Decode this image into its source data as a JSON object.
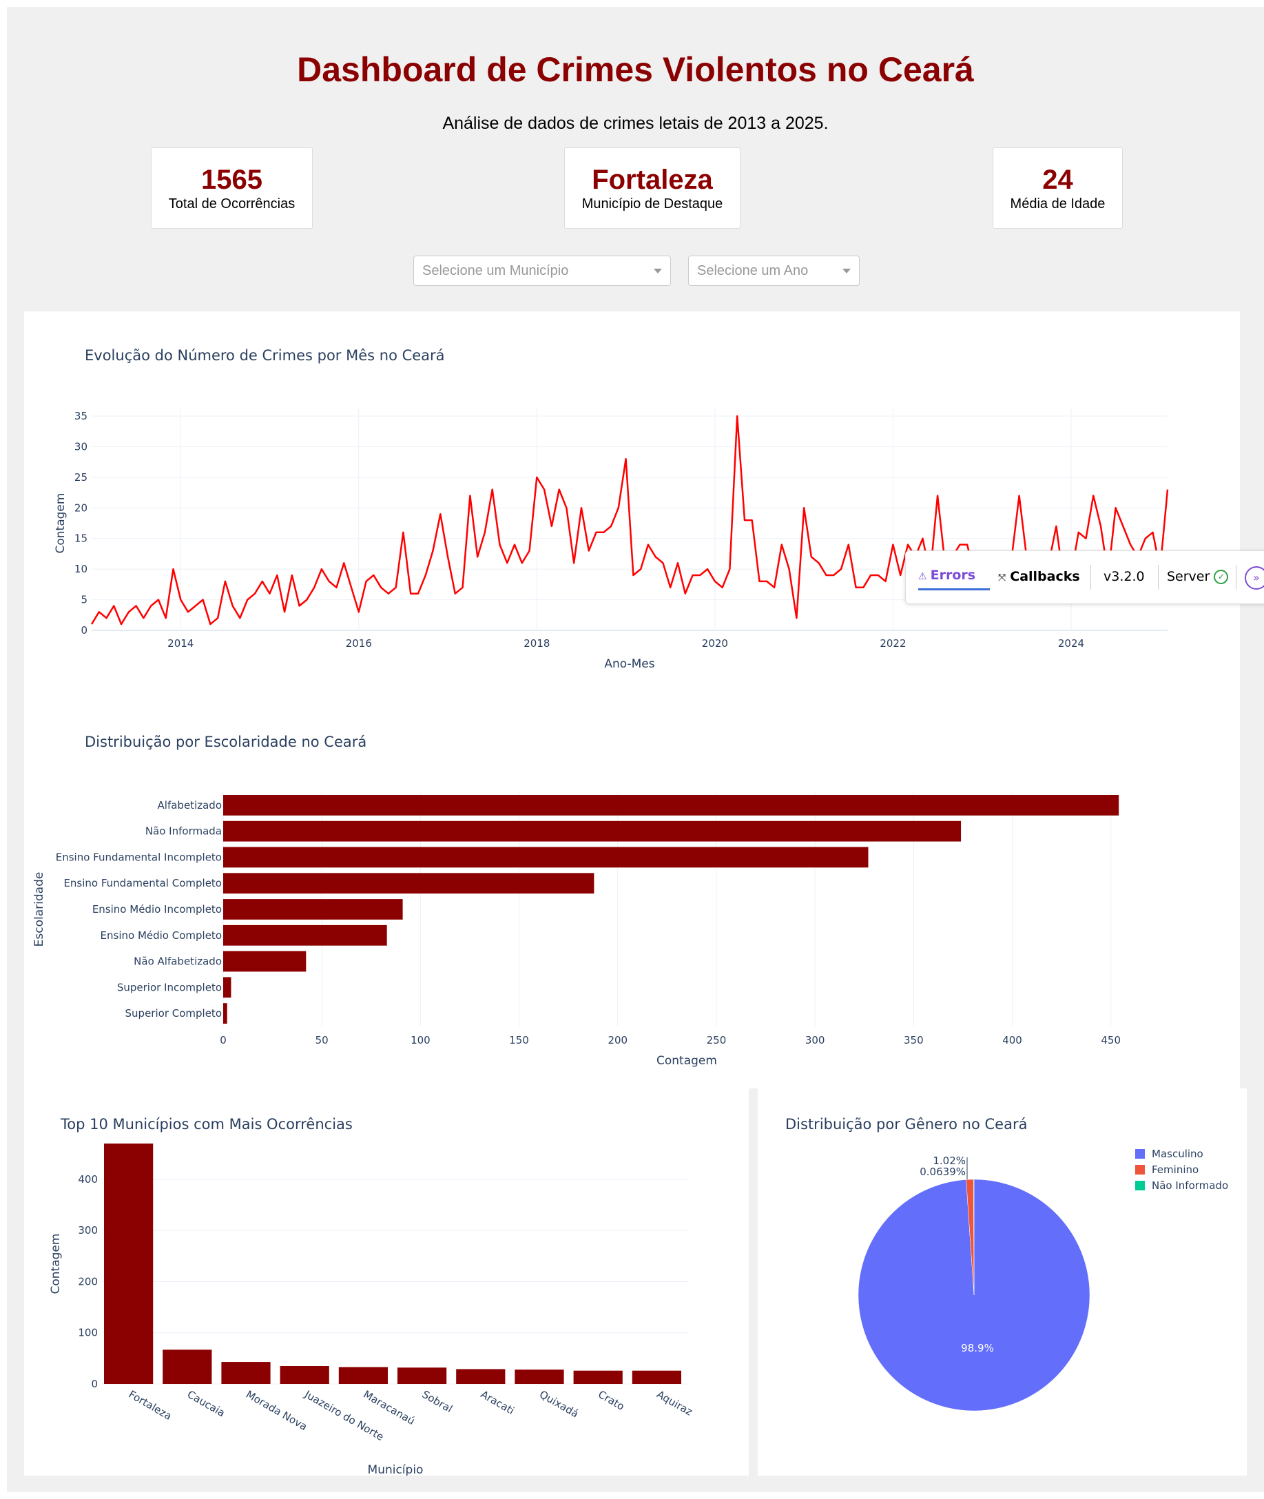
{
  "header": {
    "title": "Dashboard de Crimes Violentos no Ceará",
    "subtitle": "Análise de dados de crimes letais de 2013 a 2025."
  },
  "cards": [
    {
      "value": "1565",
      "label": "Total de Ocorrências"
    },
    {
      "value": "Fortaleza",
      "label": "Município de Destaque"
    },
    {
      "value": "24",
      "label": "Média de Idade"
    }
  ],
  "filters": {
    "municipio_placeholder": "Selecione um Município",
    "ano_placeholder": "Selecione um Ano"
  },
  "devtools": {
    "errors_label": "Errors",
    "callbacks_label": "Callbacks",
    "version": "v3.2.0",
    "server_label": "Server"
  },
  "colors": {
    "accent": "#8b0000",
    "line": "#ff0000",
    "masculino": "#636efa",
    "feminino": "#ef553b",
    "nao_informado": "#00cc96"
  },
  "chart_data": [
    {
      "type": "line",
      "title": "Evolução do Número de Crimes por Mês no Ceará",
      "xlabel": "Ano-Mes",
      "ylabel": "Contagem",
      "x_start": "2013-01",
      "x_end": "2024-12",
      "xticks": [
        "2014",
        "2016",
        "2018",
        "2020",
        "2022",
        "2024"
      ],
      "yticks": [
        0,
        5,
        10,
        15,
        20,
        25,
        30,
        35
      ],
      "ylim": [
        0,
        35
      ],
      "values": [
        1,
        3,
        2,
        4,
        1,
        3,
        4,
        2,
        4,
        5,
        2,
        10,
        5,
        3,
        4,
        5,
        1,
        2,
        8,
        4,
        2,
        5,
        6,
        8,
        6,
        9,
        3,
        9,
        4,
        5,
        7,
        10,
        8,
        7,
        11,
        7,
        3,
        8,
        9,
        7,
        6,
        7,
        16,
        6,
        6,
        9,
        13,
        19,
        12,
        6,
        7,
        22,
        12,
        16,
        23,
        14,
        11,
        14,
        11,
        13,
        25,
        23,
        17,
        23,
        20,
        11,
        20,
        13,
        16,
        16,
        17,
        20,
        28,
        9,
        10,
        14,
        12,
        11,
        7,
        11,
        6,
        9,
        9,
        10,
        8,
        7,
        10,
        35,
        18,
        18,
        8,
        8,
        7,
        14,
        10,
        2,
        20,
        12,
        11,
        9,
        9,
        10,
        14,
        7,
        7,
        9,
        9,
        8,
        14,
        9,
        14,
        12,
        15,
        9,
        22,
        11,
        12,
        14,
        14,
        9,
        10,
        8,
        11,
        11,
        12,
        22,
        12,
        12,
        10,
        11,
        17,
        8,
        9,
        16,
        15,
        22,
        17,
        9,
        20,
        17,
        14,
        12,
        15,
        16,
        10,
        23
      ],
      "grid": true
    },
    {
      "type": "bar",
      "orientation": "horizontal",
      "title": "Distribuição por Escolaridade no Ceará",
      "xlabel": "Contagem",
      "ylabel": "Escolaridade",
      "categories": [
        "Alfabetizado",
        "Não Informada",
        "Ensino Fundamental Incompleto",
        "Ensino Fundamental Completo",
        "Ensino Médio Incompleto",
        "Ensino Médio Completo",
        "Não Alfabetizado",
        "Superior Incompleto",
        "Superior Completo"
      ],
      "values": [
        454,
        374,
        327,
        188,
        91,
        83,
        42,
        4,
        2
      ],
      "xticks": [
        0,
        50,
        100,
        150,
        200,
        250,
        300,
        350,
        400,
        450
      ],
      "xlim": [
        0,
        470
      ],
      "grid": true
    },
    {
      "type": "bar",
      "title": "Top 10 Municípios com Mais Ocorrências",
      "xlabel": "Município",
      "ylabel": "Contagem",
      "categories": [
        "Fortaleza",
        "Caucaia",
        "Morada Nova",
        "Juazeiro do Norte",
        "Maracanaú",
        "Sobral",
        "Aracati",
        "Quixadá",
        "Crato",
        "Aquiraz"
      ],
      "values": [
        470,
        67,
        43,
        35,
        33,
        32,
        29,
        28,
        26,
        26
      ],
      "yticks": [
        0,
        100,
        200,
        300,
        400
      ],
      "ylim": [
        0,
        470
      ],
      "grid": true
    },
    {
      "type": "pie",
      "title": "Distribuição por Gênero no Ceará",
      "labels": [
        "Masculino",
        "Feminino",
        "Não Informado"
      ],
      "values": [
        98.9,
        1.02,
        0.0639
      ],
      "value_labels": [
        "98.9%",
        "1.02%",
        "0.0639%"
      ],
      "legend": "top-right"
    }
  ]
}
